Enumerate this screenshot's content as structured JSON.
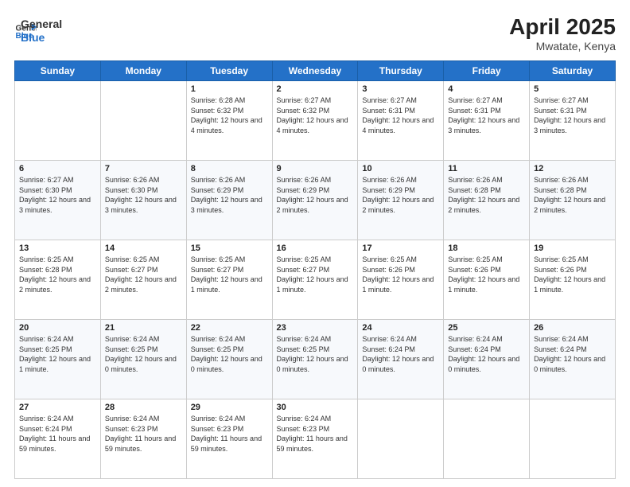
{
  "header": {
    "logo_line1": "General",
    "logo_line2": "Blue",
    "month_year": "April 2025",
    "location": "Mwatate, Kenya"
  },
  "days_of_week": [
    "Sunday",
    "Monday",
    "Tuesday",
    "Wednesday",
    "Thursday",
    "Friday",
    "Saturday"
  ],
  "weeks": [
    [
      {
        "day": "",
        "info": ""
      },
      {
        "day": "",
        "info": ""
      },
      {
        "day": "1",
        "info": "Sunrise: 6:28 AM\nSunset: 6:32 PM\nDaylight: 12 hours and 4 minutes."
      },
      {
        "day": "2",
        "info": "Sunrise: 6:27 AM\nSunset: 6:32 PM\nDaylight: 12 hours and 4 minutes."
      },
      {
        "day": "3",
        "info": "Sunrise: 6:27 AM\nSunset: 6:31 PM\nDaylight: 12 hours and 4 minutes."
      },
      {
        "day": "4",
        "info": "Sunrise: 6:27 AM\nSunset: 6:31 PM\nDaylight: 12 hours and 3 minutes."
      },
      {
        "day": "5",
        "info": "Sunrise: 6:27 AM\nSunset: 6:31 PM\nDaylight: 12 hours and 3 minutes."
      }
    ],
    [
      {
        "day": "6",
        "info": "Sunrise: 6:27 AM\nSunset: 6:30 PM\nDaylight: 12 hours and 3 minutes."
      },
      {
        "day": "7",
        "info": "Sunrise: 6:26 AM\nSunset: 6:30 PM\nDaylight: 12 hours and 3 minutes."
      },
      {
        "day": "8",
        "info": "Sunrise: 6:26 AM\nSunset: 6:29 PM\nDaylight: 12 hours and 3 minutes."
      },
      {
        "day": "9",
        "info": "Sunrise: 6:26 AM\nSunset: 6:29 PM\nDaylight: 12 hours and 2 minutes."
      },
      {
        "day": "10",
        "info": "Sunrise: 6:26 AM\nSunset: 6:29 PM\nDaylight: 12 hours and 2 minutes."
      },
      {
        "day": "11",
        "info": "Sunrise: 6:26 AM\nSunset: 6:28 PM\nDaylight: 12 hours and 2 minutes."
      },
      {
        "day": "12",
        "info": "Sunrise: 6:26 AM\nSunset: 6:28 PM\nDaylight: 12 hours and 2 minutes."
      }
    ],
    [
      {
        "day": "13",
        "info": "Sunrise: 6:25 AM\nSunset: 6:28 PM\nDaylight: 12 hours and 2 minutes."
      },
      {
        "day": "14",
        "info": "Sunrise: 6:25 AM\nSunset: 6:27 PM\nDaylight: 12 hours and 2 minutes."
      },
      {
        "day": "15",
        "info": "Sunrise: 6:25 AM\nSunset: 6:27 PM\nDaylight: 12 hours and 1 minute."
      },
      {
        "day": "16",
        "info": "Sunrise: 6:25 AM\nSunset: 6:27 PM\nDaylight: 12 hours and 1 minute."
      },
      {
        "day": "17",
        "info": "Sunrise: 6:25 AM\nSunset: 6:26 PM\nDaylight: 12 hours and 1 minute."
      },
      {
        "day": "18",
        "info": "Sunrise: 6:25 AM\nSunset: 6:26 PM\nDaylight: 12 hours and 1 minute."
      },
      {
        "day": "19",
        "info": "Sunrise: 6:25 AM\nSunset: 6:26 PM\nDaylight: 12 hours and 1 minute."
      }
    ],
    [
      {
        "day": "20",
        "info": "Sunrise: 6:24 AM\nSunset: 6:25 PM\nDaylight: 12 hours and 1 minute."
      },
      {
        "day": "21",
        "info": "Sunrise: 6:24 AM\nSunset: 6:25 PM\nDaylight: 12 hours and 0 minutes."
      },
      {
        "day": "22",
        "info": "Sunrise: 6:24 AM\nSunset: 6:25 PM\nDaylight: 12 hours and 0 minutes."
      },
      {
        "day": "23",
        "info": "Sunrise: 6:24 AM\nSunset: 6:25 PM\nDaylight: 12 hours and 0 minutes."
      },
      {
        "day": "24",
        "info": "Sunrise: 6:24 AM\nSunset: 6:24 PM\nDaylight: 12 hours and 0 minutes."
      },
      {
        "day": "25",
        "info": "Sunrise: 6:24 AM\nSunset: 6:24 PM\nDaylight: 12 hours and 0 minutes."
      },
      {
        "day": "26",
        "info": "Sunrise: 6:24 AM\nSunset: 6:24 PM\nDaylight: 12 hours and 0 minutes."
      }
    ],
    [
      {
        "day": "27",
        "info": "Sunrise: 6:24 AM\nSunset: 6:24 PM\nDaylight: 11 hours and 59 minutes."
      },
      {
        "day": "28",
        "info": "Sunrise: 6:24 AM\nSunset: 6:23 PM\nDaylight: 11 hours and 59 minutes."
      },
      {
        "day": "29",
        "info": "Sunrise: 6:24 AM\nSunset: 6:23 PM\nDaylight: 11 hours and 59 minutes."
      },
      {
        "day": "30",
        "info": "Sunrise: 6:24 AM\nSunset: 6:23 PM\nDaylight: 11 hours and 59 minutes."
      },
      {
        "day": "",
        "info": ""
      },
      {
        "day": "",
        "info": ""
      },
      {
        "day": "",
        "info": ""
      }
    ]
  ]
}
